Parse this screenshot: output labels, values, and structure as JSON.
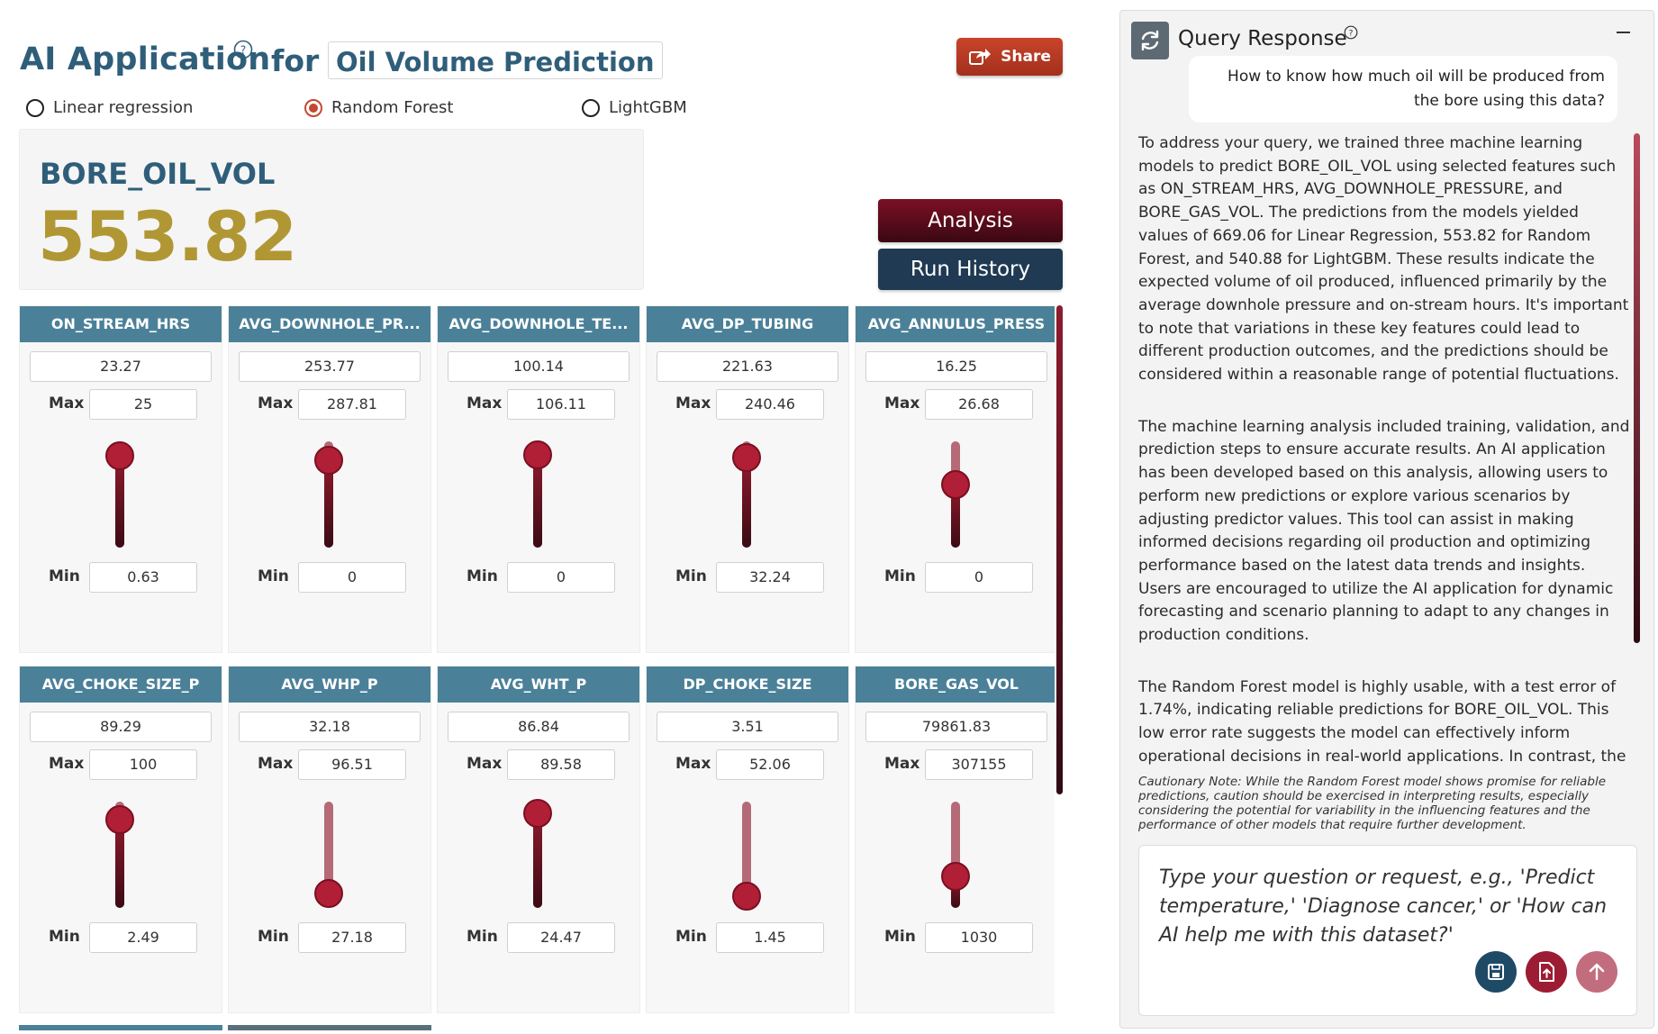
{
  "header": {
    "title": "AI Application",
    "for_label": "for",
    "app_name": "Oil Volume Prediction",
    "share_label": "Share"
  },
  "models": [
    {
      "label": "Linear regression",
      "selected": false
    },
    {
      "label": "Random Forest",
      "selected": true
    },
    {
      "label": "LightGBM",
      "selected": false
    }
  ],
  "result": {
    "label": "BORE_OIL_VOL",
    "value": "553.82"
  },
  "buttons": {
    "analysis": "Analysis",
    "run_history": "Run History"
  },
  "labels": {
    "max": "Max",
    "min": "Min"
  },
  "features": [
    {
      "name": "ON_STREAM_HRS",
      "value": "23.27",
      "max": "25",
      "min": "0.63",
      "level": 0.93
    },
    {
      "name": "AVG_DOWNHOLE_PR...",
      "value": "253.77",
      "max": "287.81",
      "min": "0",
      "level": 0.88
    },
    {
      "name": "AVG_DOWNHOLE_TE...",
      "value": "100.14",
      "max": "106.11",
      "min": "0",
      "level": 0.94
    },
    {
      "name": "AVG_DP_TUBING",
      "value": "221.63",
      "max": "240.46",
      "min": "32.24",
      "level": 0.91
    },
    {
      "name": "AVG_ANNULUS_PRESS",
      "value": "16.25",
      "max": "26.68",
      "min": "0",
      "level": 0.61
    },
    {
      "name": "AVG_CHOKE_SIZE_P",
      "value": "89.29",
      "max": "100",
      "min": "2.49",
      "level": 0.89
    },
    {
      "name": "AVG_WHP_P",
      "value": "32.18",
      "max": "96.51",
      "min": "27.18",
      "level": 0.07
    },
    {
      "name": "AVG_WHT_P",
      "value": "86.84",
      "max": "89.58",
      "min": "24.47",
      "level": 0.96
    },
    {
      "name": "DP_CHOKE_SIZE",
      "value": "3.51",
      "max": "52.06",
      "min": "1.45",
      "level": 0.04
    },
    {
      "name": "BORE_GAS_VOL",
      "value": "79861.83",
      "max": "307155",
      "min": "1030",
      "level": 0.26
    }
  ],
  "panel": {
    "title": "Query Response",
    "user_question": "How to know how much oil will be produced from the bore using this data?",
    "response_paragraphs": [
      "To address your query, we trained three machine learning models to predict BORE_OIL_VOL using selected features such as ON_STREAM_HRS, AVG_DOWNHOLE_PRESSURE, and BORE_GAS_VOL. The predictions from the models yielded values of 669.06 for Linear Regression, 553.82 for Random Forest, and 540.88 for LightGBM. These results indicate the expected volume of oil produced, influenced primarily by the average downhole pressure and on-stream hours. It's important to note that variations in these key features could lead to different production outcomes, and the predictions should be considered within a reasonable range of potential fluctuations.",
      "The machine learning analysis included training, validation, and prediction steps to ensure accurate results. An AI application has been developed based on this analysis, allowing users to perform new predictions or explore various scenarios by adjusting predictor values. This tool can assist in making informed decisions regarding oil production and optimizing performance based on the latest data trends and insights. Users are encouraged to utilize the AI application for dynamic forecasting and scenario planning to adapt to any changes in production conditions.",
      "The Random Forest model is highly usable, with a test error of 1.74%, indicating reliable predictions for BORE_OIL_VOL. This low error rate suggests the model can effectively inform operational decisions in real-world applications. In contrast, the"
    ],
    "caution": "Cautionary Note: While the Random Forest model shows promise for reliable predictions, caution should be exercised in interpreting results, especially considering the potential for variability in the influencing features and the performance of other models that require further development.",
    "input_placeholder": "Type your question or request, e.g., 'Predict temperature,' 'Diagnose cancer,' or 'How can AI help me with this dataset?'"
  },
  "colors": {
    "title": "#2f5e7a",
    "value": "#b19734",
    "card_header": "#4b8198",
    "slider": "#b01f36",
    "share": "#c8442a",
    "run_history": "#1f3a52"
  }
}
